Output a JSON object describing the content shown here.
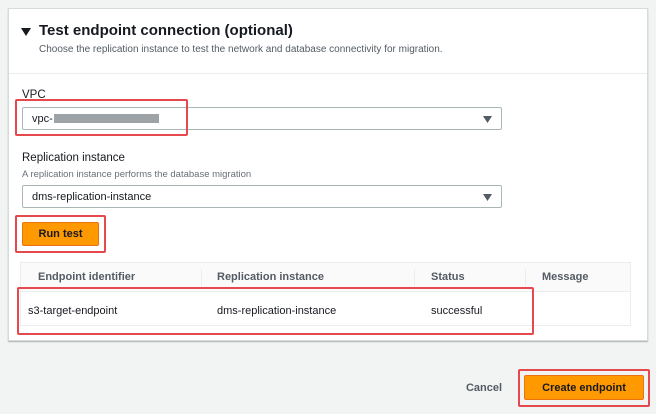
{
  "section": {
    "title": "Test endpoint connection (optional)",
    "description": "Choose the replication instance to test the network and database connectivity for migration."
  },
  "vpc": {
    "label": "VPC",
    "value_prefix": "vpc-"
  },
  "replication": {
    "label": "Replication instance",
    "hint": "A replication instance performs the database migration",
    "value": "dms-replication-instance"
  },
  "run_test_label": "Run test",
  "table": {
    "columns": [
      "Endpoint identifier",
      "Replication instance",
      "Status",
      "Message"
    ],
    "rows": [
      [
        "s3-target-endpoint",
        "dms-replication-instance",
        "successful",
        ""
      ]
    ]
  },
  "footer": {
    "cancel_label": "Cancel",
    "create_label": "Create endpoint"
  },
  "colors": {
    "accent": "#ff9900",
    "highlight": "#e5484d"
  },
  "icons": {
    "collapse": "caret-down-filled-icon",
    "select_caret": "caret-down-icon"
  }
}
